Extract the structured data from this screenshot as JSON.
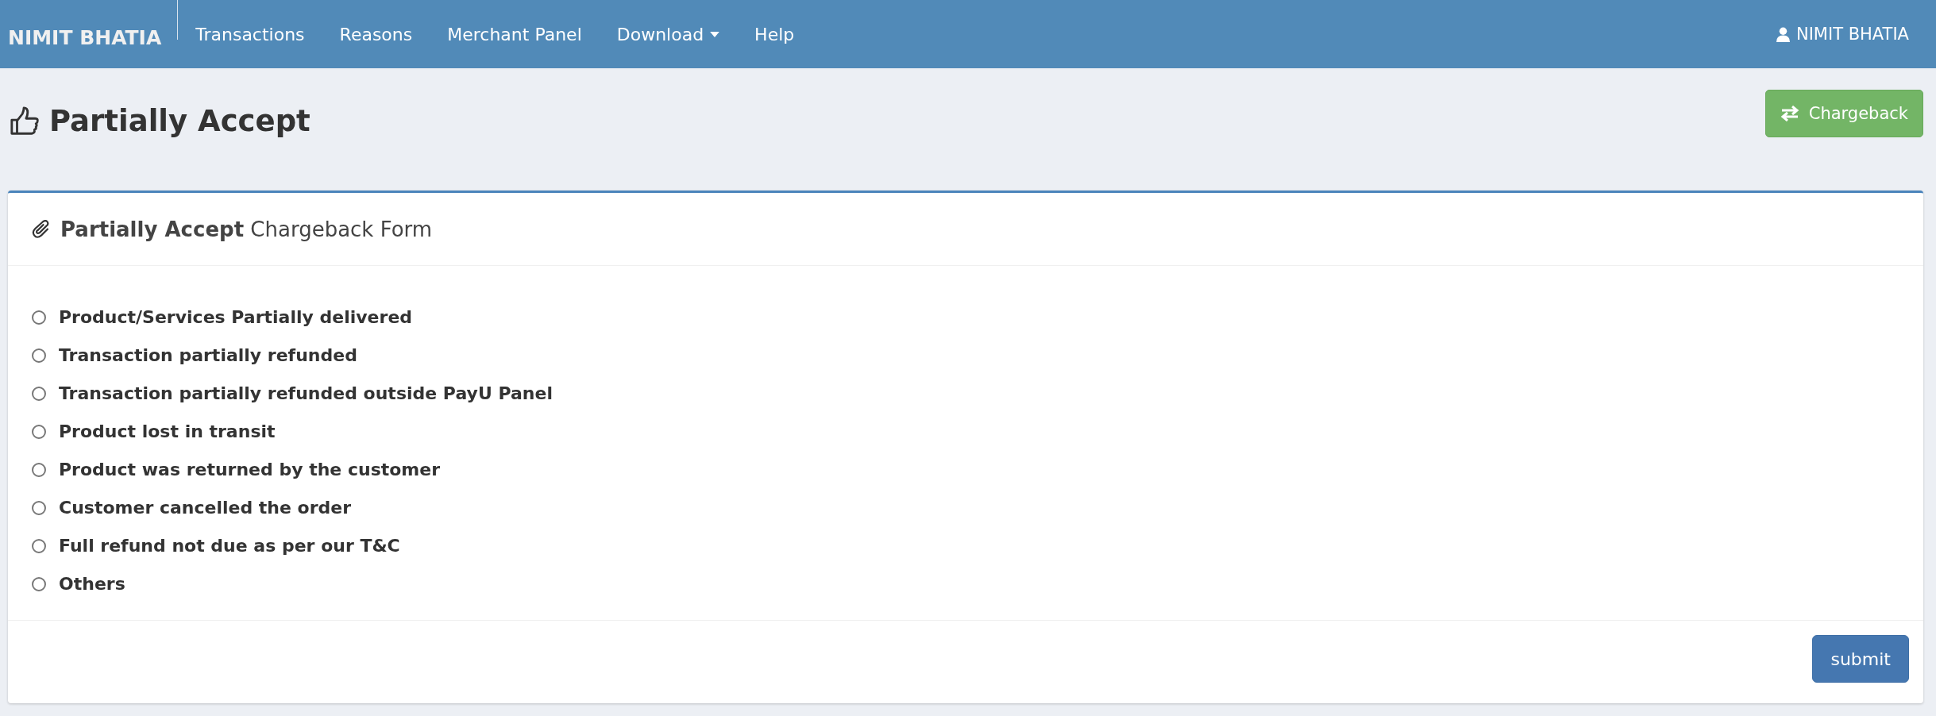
{
  "navbar": {
    "brand": "NIMIT BHATIA",
    "items": [
      {
        "label": "Transactions",
        "dropdown": false
      },
      {
        "label": "Reasons",
        "dropdown": false
      },
      {
        "label": "Merchant Panel",
        "dropdown": false
      },
      {
        "label": "Download",
        "dropdown": true
      },
      {
        "label": "Help",
        "dropdown": false
      }
    ],
    "user": "NIMIT BHATIA"
  },
  "page": {
    "title": "Partially Accept",
    "action_button": "Chargeback"
  },
  "panel": {
    "heading": "**Partially Accept** Chargeback Form",
    "options": [
      {
        "label": "Product/Services Partially delivered",
        "selected": false
      },
      {
        "label": "Transaction partially refunded",
        "selected": false
      },
      {
        "label": "Transaction partially refunded outside PayU Panel",
        "selected": false
      },
      {
        "label": "Product lost in transit",
        "selected": false
      },
      {
        "label": "Product was returned by the customer",
        "selected": false
      },
      {
        "label": "Customer cancelled the order",
        "selected": false
      },
      {
        "label": "Full refund not due as per our T&C",
        "selected": false
      },
      {
        "label": "Others",
        "selected": false
      }
    ],
    "submit": "submit"
  }
}
